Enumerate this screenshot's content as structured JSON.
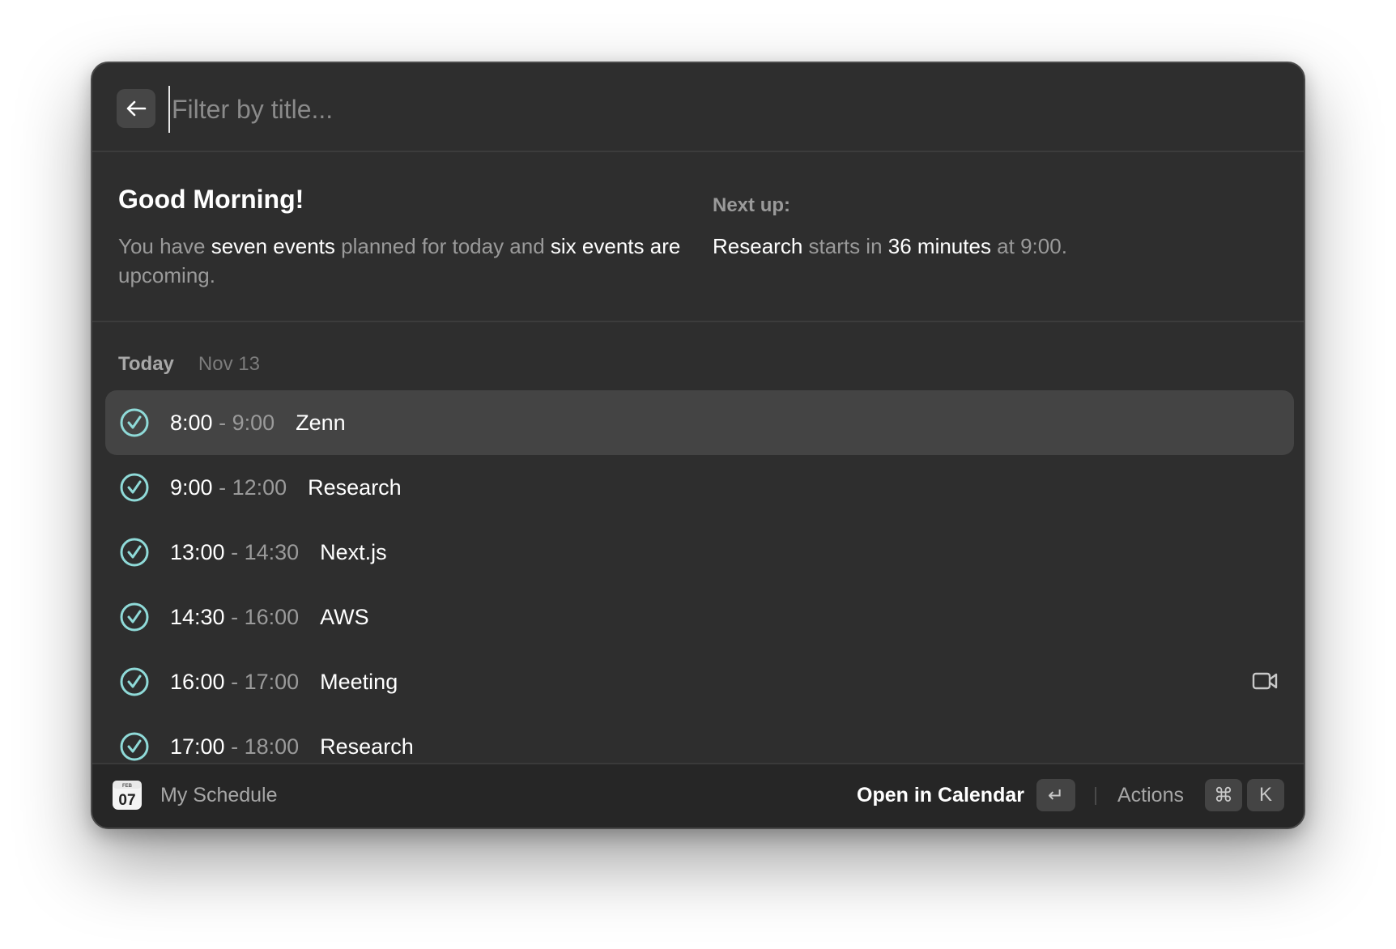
{
  "search": {
    "placeholder": "Filter by title..."
  },
  "greeting": {
    "title": "Good Morning!",
    "text": [
      {
        "t": "You have ",
        "hl": false
      },
      {
        "t": "seven events",
        "hl": true
      },
      {
        "t": " planned for today and ",
        "hl": false
      },
      {
        "t": "six events are",
        "hl": true
      },
      {
        "t": " upcoming.",
        "hl": false
      }
    ],
    "next_label": "Next up:",
    "next_text": [
      {
        "t": "Research",
        "hl": true
      },
      {
        "t": " starts in ",
        "hl": false
      },
      {
        "t": "36 minutes",
        "hl": true
      },
      {
        "t": " at 9:00.",
        "hl": false
      }
    ]
  },
  "section": {
    "label": "Today",
    "date": "Nov 13"
  },
  "events": [
    {
      "start": "8:00",
      "sep": " - ",
      "end": "9:00",
      "title": "Zenn",
      "selected": true,
      "video": false
    },
    {
      "start": "9:00",
      "sep": " - ",
      "end": "12:00",
      "title": "Research",
      "selected": false,
      "video": false
    },
    {
      "start": "13:00",
      "sep": " - ",
      "end": "14:30",
      "title": "Next.js",
      "selected": false,
      "video": false
    },
    {
      "start": "14:30",
      "sep": " - ",
      "end": "16:00",
      "title": "AWS",
      "selected": false,
      "video": false
    },
    {
      "start": "16:00",
      "sep": " - ",
      "end": "17:00",
      "title": "Meeting",
      "selected": false,
      "video": true
    },
    {
      "start": "17:00",
      "sep": " - ",
      "end": "18:00",
      "title": "Research",
      "selected": false,
      "video": false
    }
  ],
  "footer": {
    "app_icon": {
      "month": "FEB",
      "day": "07"
    },
    "title": "My Schedule",
    "primary_action": "Open in Calendar",
    "enter_key": "↵",
    "actions_label": "Actions",
    "cmd_key": "⌘",
    "k_key": "K"
  },
  "colors": {
    "accent_check": "#8fdad8",
    "background": "#2e2e2e",
    "selected_row": "#444444"
  }
}
